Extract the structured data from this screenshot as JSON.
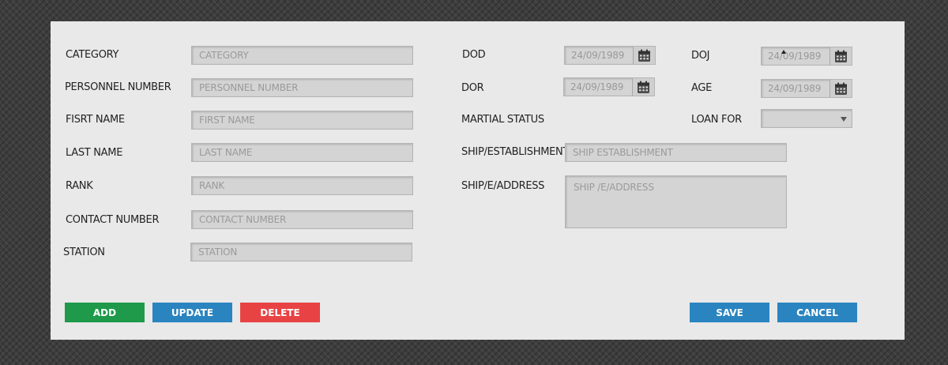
{
  "form": {
    "left": [
      {
        "label": "CATEGORY",
        "placeholder": "CATEGORY"
      },
      {
        "label": "PERSONNEL NUMBER",
        "placeholder": "PERSONNEL NUMBER"
      },
      {
        "label": "FISRT NAME",
        "placeholder": "FIRST NAME"
      },
      {
        "label": "LAST NAME",
        "placeholder": "LAST NAME"
      },
      {
        "label": "RANK",
        "placeholder": "RANK"
      },
      {
        "label": "CONTACT NUMBER",
        "placeholder": "CONTACT NUMBER"
      },
      {
        "label": "STATION",
        "placeholder": "STATION"
      }
    ],
    "dod": {
      "label": "DOD",
      "value": "24/09/1989"
    },
    "doj": {
      "label": "DOJ",
      "value": "24/09/1989"
    },
    "dor": {
      "label": "DOR",
      "value": "24/09/1989"
    },
    "age": {
      "label": "AGE",
      "value": "24/09/1989"
    },
    "martial_status": {
      "label": "MARTIAL STATUS"
    },
    "loan_for": {
      "label": "LOAN FOR",
      "value": ""
    },
    "ship_establishment": {
      "label": "SHIP/ESTABLISHMENT",
      "placeholder": "SHIP ESTABLISHMENT"
    },
    "ship_address": {
      "label": "SHIP/E/ADDRESS",
      "placeholder": "SHIP /E/ADDRESS"
    }
  },
  "actions": {
    "add": "ADD",
    "update": "UPDATE",
    "delete": "DELETE",
    "save": "SAVE",
    "cancel": "CANCEL"
  },
  "icons": {
    "calendar": "calendar-icon",
    "dropdown": "chevron-down-icon"
  },
  "colors": {
    "add": "#1e9a4a",
    "update": "#2a84c0",
    "delete": "#e84344",
    "save": "#2a84c0",
    "cancel": "#2a84c0"
  }
}
